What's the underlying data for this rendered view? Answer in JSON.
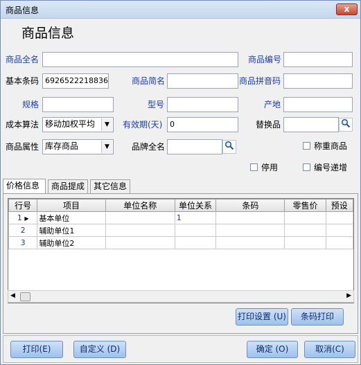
{
  "window": {
    "title": "商品信息",
    "close": "x"
  },
  "heading": "商品信息",
  "form": {
    "full_name": {
      "label": "商品全名",
      "value": ""
    },
    "code": {
      "label": "商品编号",
      "value": ""
    },
    "barcode": {
      "label": "基本条码",
      "value": "6926522218836"
    },
    "short_name": {
      "label": "商品简名",
      "value": ""
    },
    "pinyin": {
      "label": "商品拼音码",
      "value": ""
    },
    "spec": {
      "label": "规格",
      "value": ""
    },
    "model": {
      "label": "型号",
      "value": ""
    },
    "origin": {
      "label": "产地",
      "value": ""
    },
    "cost_method": {
      "label": "成本算法",
      "value": "移动加权平均"
    },
    "shelf_life": {
      "label": "有效期(天)",
      "value": "0"
    },
    "substitute": {
      "label": "替换品",
      "value": ""
    },
    "attribute": {
      "label": "商品属性",
      "value": "库存商品"
    },
    "brand": {
      "label": "品牌全名",
      "value": ""
    },
    "weighing": {
      "label": "称重商品"
    },
    "disabled": {
      "label": "停用"
    },
    "auto_increment": {
      "label": "编号递增"
    }
  },
  "tabs": [
    "价格信息",
    "商品提成",
    "其它信息"
  ],
  "table": {
    "columns": [
      "行号",
      "项目",
      "单位名称",
      "单位关系",
      "条码",
      "零售价",
      "预设"
    ],
    "rows": [
      {
        "no": "1",
        "item": "基本单位",
        "unit": "",
        "relation": "1",
        "barcode": "",
        "price": "",
        "preset": ""
      },
      {
        "no": "2",
        "item": "辅助单位1",
        "unit": "",
        "relation": "",
        "barcode": "",
        "price": "",
        "preset": ""
      },
      {
        "no": "3",
        "item": "辅助单位2",
        "unit": "",
        "relation": "",
        "barcode": "",
        "price": "",
        "preset": ""
      }
    ]
  },
  "panel_buttons": {
    "print_settings": "打印设置 (U)",
    "barcode_print": "条码打印"
  },
  "footer": {
    "print": "打印(E)",
    "customize": "自定义 (D)",
    "ok": "确定 (O)",
    "cancel": "取消(C)"
  },
  "icons": {
    "lookup": "magnifier-icon",
    "dropdown": "chevron-down-icon"
  }
}
